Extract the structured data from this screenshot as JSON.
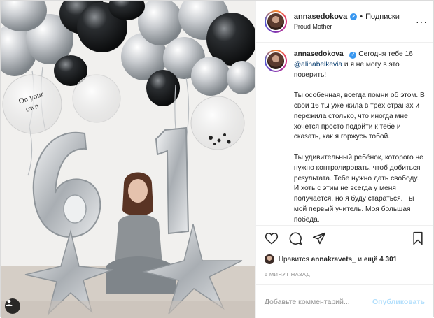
{
  "header": {
    "username": "annasedokova",
    "follow_label": "Подписки",
    "dot": "•",
    "subtitle": "Proud Mother",
    "more": "···"
  },
  "caption": {
    "username": "annasedokova",
    "paragraphs": [
      "Сегодня тебе 16",
      "и я не могу в это поверить!",
      "Ты особенная, всегда помни об этом. В свои 16 ты уже жила в трёх странах и пережила столько, что иногда мне хочется просто подойти к тебе и сказать, как я горжусь тобой.",
      "Ты удивительный ребёнок, которого не нужно контролировать, чтоб добиться результата. Тебе нужно дать свободу. И хоть с этим не всегда у меня получается, но я буду стараться. Ты мой первый учитель. Моя большая победа."
    ],
    "mention": "@alinabelkevia"
  },
  "actions": {
    "like_icon": "heart-icon",
    "comment_icon": "comment-icon",
    "share_icon": "share-icon",
    "save_icon": "bookmark-icon"
  },
  "likes": {
    "prefix": "Нравится",
    "user": "annakravets_",
    "middle": "и",
    "count": "ещё 4 301"
  },
  "timestamp": "6 МИНУТ НАЗАД",
  "comment_box": {
    "placeholder": "Добавьте комментарий...",
    "publish_label": "Опубликовать"
  },
  "photo": {
    "balloon_text": "On your own",
    "number_left": "6",
    "number_right": "1"
  },
  "colors": {
    "verified": "#3897f0",
    "mention": "#00376b",
    "publish_disabled": "#b2dffc"
  }
}
